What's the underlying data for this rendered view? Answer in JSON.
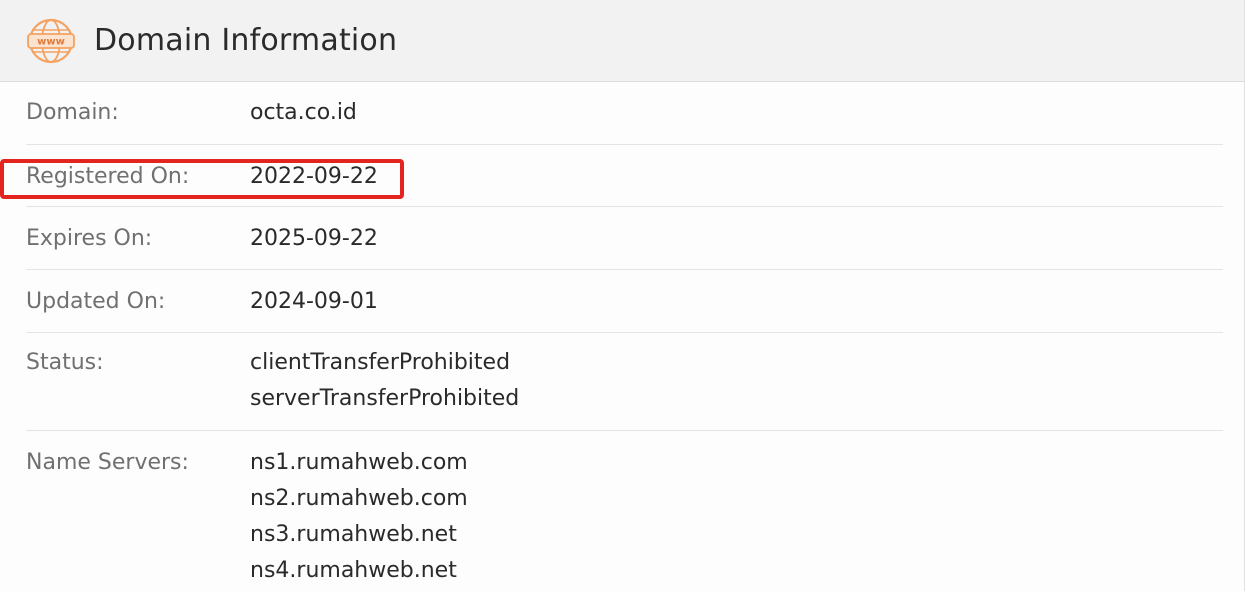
{
  "header": {
    "title": "Domain Information",
    "icon": "www-globe-icon",
    "icon_text": "www",
    "icon_color": "#f4a261"
  },
  "rows": {
    "domain": {
      "label": "Domain:",
      "value": "octa.co.id"
    },
    "registered": {
      "label": "Registered On:",
      "value": "2022-09-22"
    },
    "expires": {
      "label": "Expires On:",
      "value": "2025-09-22"
    },
    "updated": {
      "label": "Updated On:",
      "value": "2024-09-01"
    },
    "status": {
      "label": "Status:",
      "values": [
        "clientTransferProhibited",
        "serverTransferProhibited"
      ]
    },
    "nameservers": {
      "label": "Name Servers:",
      "values": [
        "ns1.rumahweb.com",
        "ns2.rumahweb.com",
        "ns3.rumahweb.net",
        "ns4.rumahweb.net"
      ]
    }
  },
  "colors": {
    "highlight": "#e3241f",
    "header_bg": "#f2f2f2",
    "label": "#707070",
    "value": "#2a2a2a"
  }
}
